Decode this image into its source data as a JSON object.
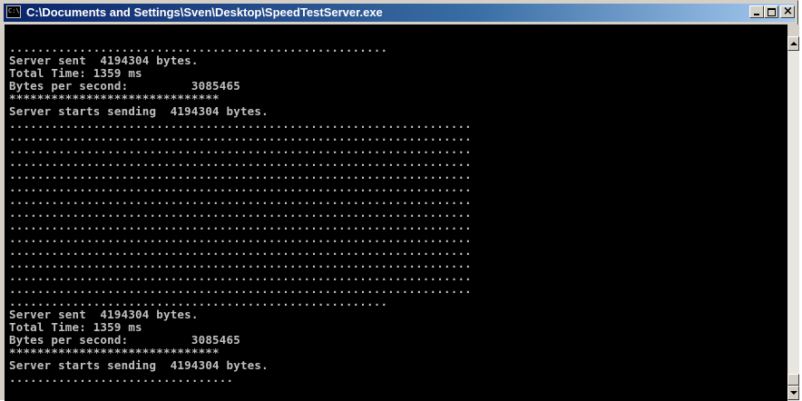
{
  "window": {
    "title": "C:\\Documents and Settings\\Sven\\Desktop\\SpeedTestServer.exe",
    "icon_label": "C:\\",
    "icon": "console-window-icon",
    "controls": [
      "minimize-icon",
      "maximize-icon",
      "close-icon"
    ]
  },
  "console": {
    "lines": [
      "......................................................",
      "Server sent  4194304 bytes.",
      "Total Time: 1359 ms",
      "Bytes per second:         3085465",
      "******************************",
      "Server starts sending  4194304 bytes.",
      "..................................................................",
      "..................................................................",
      "..................................................................",
      "..................................................................",
      "..................................................................",
      "..................................................................",
      "..................................................................",
      "..................................................................",
      "..................................................................",
      "..................................................................",
      "..................................................................",
      "..................................................................",
      "..................................................................",
      "..................................................................",
      "......................................................",
      "Server sent  4194304 bytes.",
      "Total Time: 1359 ms",
      "Bytes per second:         3085465",
      "******************************",
      "Server starts sending  4194304 bytes.",
      "................................"
    ]
  },
  "colors": {
    "title_bar_start": "#0a246a",
    "title_bar_end": "#a6caf0",
    "console_background": "#000000",
    "console_text": "#c0c0c0"
  }
}
